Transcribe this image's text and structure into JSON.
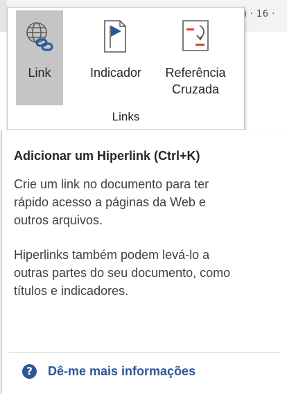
{
  "ruler": {
    "text": "ı · 16 ·"
  },
  "ribbon": {
    "group_title": "Links",
    "buttons": [
      {
        "label": "Link",
        "icon": "globe-link-icon",
        "selected": true
      },
      {
        "label": "Indicador",
        "icon": "bookmark-icon"
      },
      {
        "label_line1": "Referência",
        "label_line2": "Cruzada",
        "icon": "cross-reference-icon"
      }
    ]
  },
  "tooltip": {
    "title": "Adicionar um Hiperlink (Ctrl+K)",
    "paragraph1": "Crie um link no documento para ter rápido acesso a páginas da Web e outros arquivos.",
    "paragraph2": "Hiperlinks também podem levá-lo a outras partes do seu documento, como títulos e indicadores.",
    "more_info": "Dê-me mais informações",
    "help_glyph": "?"
  },
  "colors": {
    "accent": "#2b579a",
    "selected_button_bg": "#c5c5c5",
    "crossref_red": "#d9432f"
  }
}
